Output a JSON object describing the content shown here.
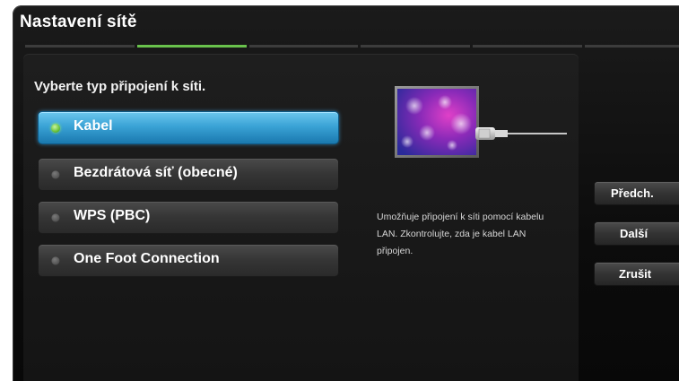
{
  "window": {
    "title": "Nastavení sítě"
  },
  "steps": {
    "count": 6,
    "active_index": 1,
    "active_color": "#69c24c",
    "inactive_color": "#3c3c3c"
  },
  "prompt": "Vyberte typ připojení k síti.",
  "options": [
    {
      "label": "Kabel",
      "selected": true
    },
    {
      "label": "Bezdrátová síť (obecné)",
      "selected": false
    },
    {
      "label": "WPS (PBC)",
      "selected": false
    },
    {
      "label": "One Foot Connection",
      "selected": false
    }
  ],
  "illustration": {
    "icon": "tv-lan-cable-icon"
  },
  "description": "Umožňuje připojení k síti pomocí kabelu LAN. Zkontrolujte, zda je kabel LAN připojen.",
  "buttons": {
    "previous": "Předch.",
    "next": "Další",
    "cancel": "Zrušit"
  },
  "colors": {
    "selection_blue": "#3aa3d6",
    "radio_green": "#6ac23a",
    "background": "#0c0c0c"
  }
}
